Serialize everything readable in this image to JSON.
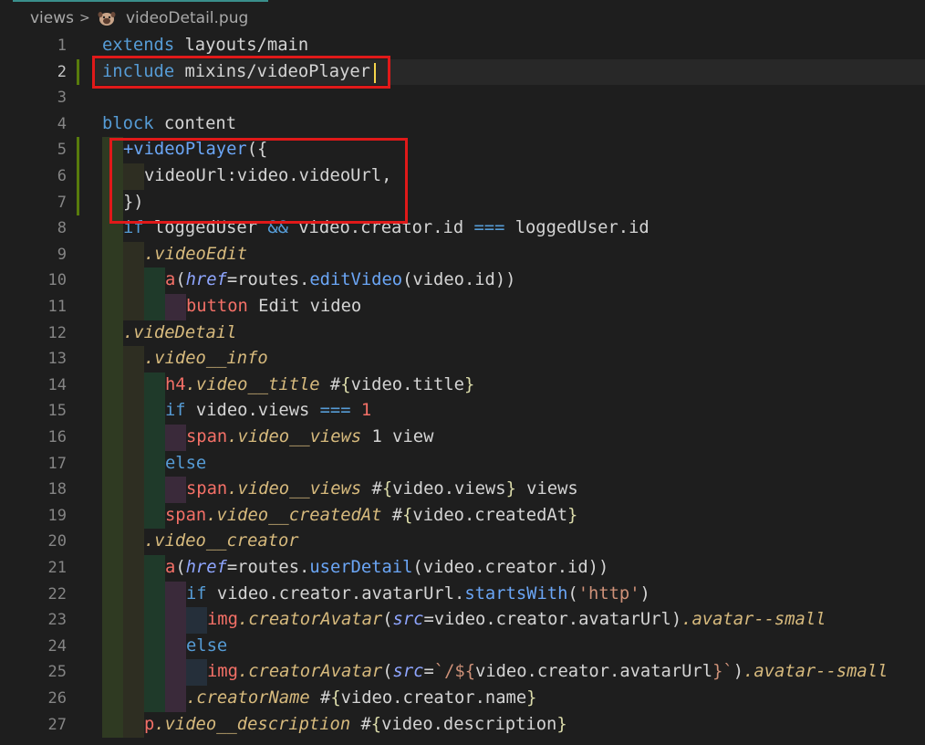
{
  "breadcrumb": {
    "folder": "views",
    "separator": ">",
    "file_icon": "pug-file-icon",
    "file": "videoDetail.pug"
  },
  "cursor_line": 2,
  "lines": [
    {
      "n": "1",
      "indent": 0,
      "tokens": [
        [
          "kw",
          "extends"
        ],
        [
          "pl",
          " layouts/main"
        ]
      ]
    },
    {
      "n": "2",
      "indent": 0,
      "tokens": [
        [
          "kw",
          "include"
        ],
        [
          "pl",
          " mixins/videoPlayer"
        ]
      ]
    },
    {
      "n": "3",
      "indent": 0,
      "tokens": []
    },
    {
      "n": "4",
      "indent": 0,
      "tokens": [
        [
          "kw",
          "block"
        ],
        [
          "pl",
          " content"
        ]
      ]
    },
    {
      "n": "5",
      "indent": 1,
      "tokens": [
        [
          "fn",
          "+videoPlayer"
        ],
        [
          "op",
          "({"
        ]
      ]
    },
    {
      "n": "6",
      "indent": 2,
      "tokens": [
        [
          "pl",
          "videoUrl:video.videoUrl,"
        ]
      ]
    },
    {
      "n": "7",
      "indent": 1,
      "tokens": [
        [
          "op",
          "})"
        ]
      ]
    },
    {
      "n": "8",
      "indent": 1,
      "tokens": [
        [
          "kw",
          "if"
        ],
        [
          "pl",
          " loggedUser "
        ],
        [
          "kw",
          "&&"
        ],
        [
          "pl",
          " video.creator.id "
        ],
        [
          "kw",
          "==="
        ],
        [
          "pl",
          " loggedUser.id"
        ]
      ]
    },
    {
      "n": "9",
      "indent": 2,
      "tokens": [
        [
          "cls",
          ".videoEdit"
        ]
      ]
    },
    {
      "n": "10",
      "indent": 3,
      "tokens": [
        [
          "tag",
          "a"
        ],
        [
          "op",
          "("
        ],
        [
          "attr",
          "href"
        ],
        [
          "op",
          "="
        ],
        [
          "pl",
          "routes."
        ],
        [
          "fn",
          "editVideo"
        ],
        [
          "op",
          "("
        ],
        [
          "pl",
          "video.id"
        ],
        [
          "op",
          "))"
        ]
      ]
    },
    {
      "n": "11",
      "indent": 4,
      "tokens": [
        [
          "tag",
          "button"
        ],
        [
          "pl",
          " Edit video"
        ]
      ]
    },
    {
      "n": "12",
      "indent": 1,
      "tokens": [
        [
          "cls",
          ".videDetail"
        ]
      ]
    },
    {
      "n": "13",
      "indent": 2,
      "tokens": [
        [
          "cls",
          ".video__info"
        ]
      ]
    },
    {
      "n": "14",
      "indent": 3,
      "tokens": [
        [
          "tag",
          "h4"
        ],
        [
          "cls",
          ".video__title"
        ],
        [
          "pl",
          " #"
        ],
        [
          "brace",
          "{"
        ],
        [
          "pl",
          "video.title"
        ],
        [
          "brace",
          "}"
        ]
      ]
    },
    {
      "n": "15",
      "indent": 3,
      "tokens": [
        [
          "kw",
          "if"
        ],
        [
          "pl",
          " video.views "
        ],
        [
          "kw",
          "==="
        ],
        [
          "num",
          " 1"
        ]
      ]
    },
    {
      "n": "16",
      "indent": 4,
      "tokens": [
        [
          "tag",
          "span"
        ],
        [
          "cls",
          ".video__views"
        ],
        [
          "pl",
          " 1 view"
        ]
      ]
    },
    {
      "n": "17",
      "indent": 3,
      "tokens": [
        [
          "kw",
          "else"
        ]
      ]
    },
    {
      "n": "18",
      "indent": 4,
      "tokens": [
        [
          "tag",
          "span"
        ],
        [
          "cls",
          ".video__views"
        ],
        [
          "pl",
          " #"
        ],
        [
          "brace",
          "{"
        ],
        [
          "pl",
          "video.views"
        ],
        [
          "brace",
          "}"
        ],
        [
          "pl",
          " views"
        ]
      ]
    },
    {
      "n": "19",
      "indent": 3,
      "tokens": [
        [
          "tag",
          "span"
        ],
        [
          "cls",
          ".video__createdAt"
        ],
        [
          "pl",
          " #"
        ],
        [
          "brace",
          "{"
        ],
        [
          "pl",
          "video.createdAt"
        ],
        [
          "brace",
          "}"
        ]
      ]
    },
    {
      "n": "20",
      "indent": 2,
      "tokens": [
        [
          "cls",
          ".video__creator"
        ]
      ]
    },
    {
      "n": "21",
      "indent": 3,
      "tokens": [
        [
          "tag",
          "a"
        ],
        [
          "op",
          "("
        ],
        [
          "attr",
          "href"
        ],
        [
          "op",
          "="
        ],
        [
          "pl",
          "routes."
        ],
        [
          "fn",
          "userDetail"
        ],
        [
          "op",
          "("
        ],
        [
          "pl",
          "video.creator.id"
        ],
        [
          "op",
          "))"
        ]
      ]
    },
    {
      "n": "22",
      "indent": 4,
      "tokens": [
        [
          "kw",
          "if"
        ],
        [
          "pl",
          " video.creator.avatarUrl."
        ],
        [
          "fn",
          "startsWith"
        ],
        [
          "op",
          "("
        ],
        [
          "str",
          "'http'"
        ],
        [
          "op",
          ")"
        ]
      ]
    },
    {
      "n": "23",
      "indent": 5,
      "tokens": [
        [
          "tag",
          "img"
        ],
        [
          "cls",
          ".creatorAvatar"
        ],
        [
          "op",
          "("
        ],
        [
          "attr",
          "src"
        ],
        [
          "op",
          "="
        ],
        [
          "pl",
          "video.creator.avatarUrl"
        ],
        [
          "op",
          ")"
        ],
        [
          "cls",
          ".avatar--small"
        ]
      ]
    },
    {
      "n": "24",
      "indent": 4,
      "tokens": [
        [
          "kw",
          "else"
        ]
      ]
    },
    {
      "n": "25",
      "indent": 5,
      "tokens": [
        [
          "tag",
          "img"
        ],
        [
          "cls",
          ".creatorAvatar"
        ],
        [
          "op",
          "("
        ],
        [
          "attr",
          "src"
        ],
        [
          "op",
          "="
        ],
        [
          "str",
          "`/${"
        ],
        [
          "pl",
          "video.creator.avatarUrl"
        ],
        [
          "str",
          "}`"
        ],
        [
          "op",
          ")"
        ],
        [
          "cls",
          ".avatar--small"
        ]
      ]
    },
    {
      "n": "26",
      "indent": 4,
      "tokens": [
        [
          "cls",
          ".creatorName"
        ],
        [
          "pl",
          " #"
        ],
        [
          "brace",
          "{"
        ],
        [
          "pl",
          "video.creator.name"
        ],
        [
          "brace",
          "}"
        ]
      ]
    },
    {
      "n": "27",
      "indent": 2,
      "tokens": [
        [
          "tag",
          "p"
        ],
        [
          "cls",
          ".video__description"
        ],
        [
          "pl",
          " #"
        ],
        [
          "brace",
          "{"
        ],
        [
          "pl",
          "video.description"
        ],
        [
          "brace",
          "}"
        ]
      ]
    }
  ]
}
